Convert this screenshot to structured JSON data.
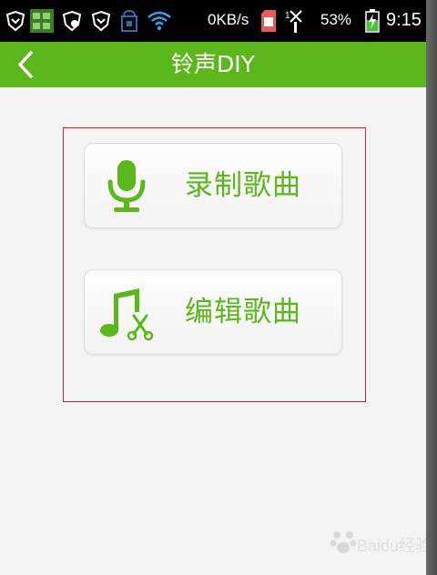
{
  "status_bar": {
    "network_speed": "0KB/s",
    "battery_percent": "53%",
    "time": "9:15",
    "icons": [
      "shield-icon",
      "app-notification-icon",
      "shield-icon",
      "shield-icon",
      "sim-icon",
      "wifi-icon",
      "sd-card-icon",
      "signal-icon",
      "battery-charging-icon"
    ]
  },
  "header": {
    "title": "铃声DIY",
    "back_icon": "back-arrow-icon"
  },
  "actions": [
    {
      "label": "录制歌曲",
      "icon": "microphone-icon"
    },
    {
      "label": "编辑歌曲",
      "icon": "music-note-scissors-icon"
    }
  ],
  "watermark": {
    "text": "Baidu经验"
  },
  "colors": {
    "brand_green": "#5cb71c",
    "highlight_border": "#c8252b",
    "background": "#f4f4f4"
  }
}
